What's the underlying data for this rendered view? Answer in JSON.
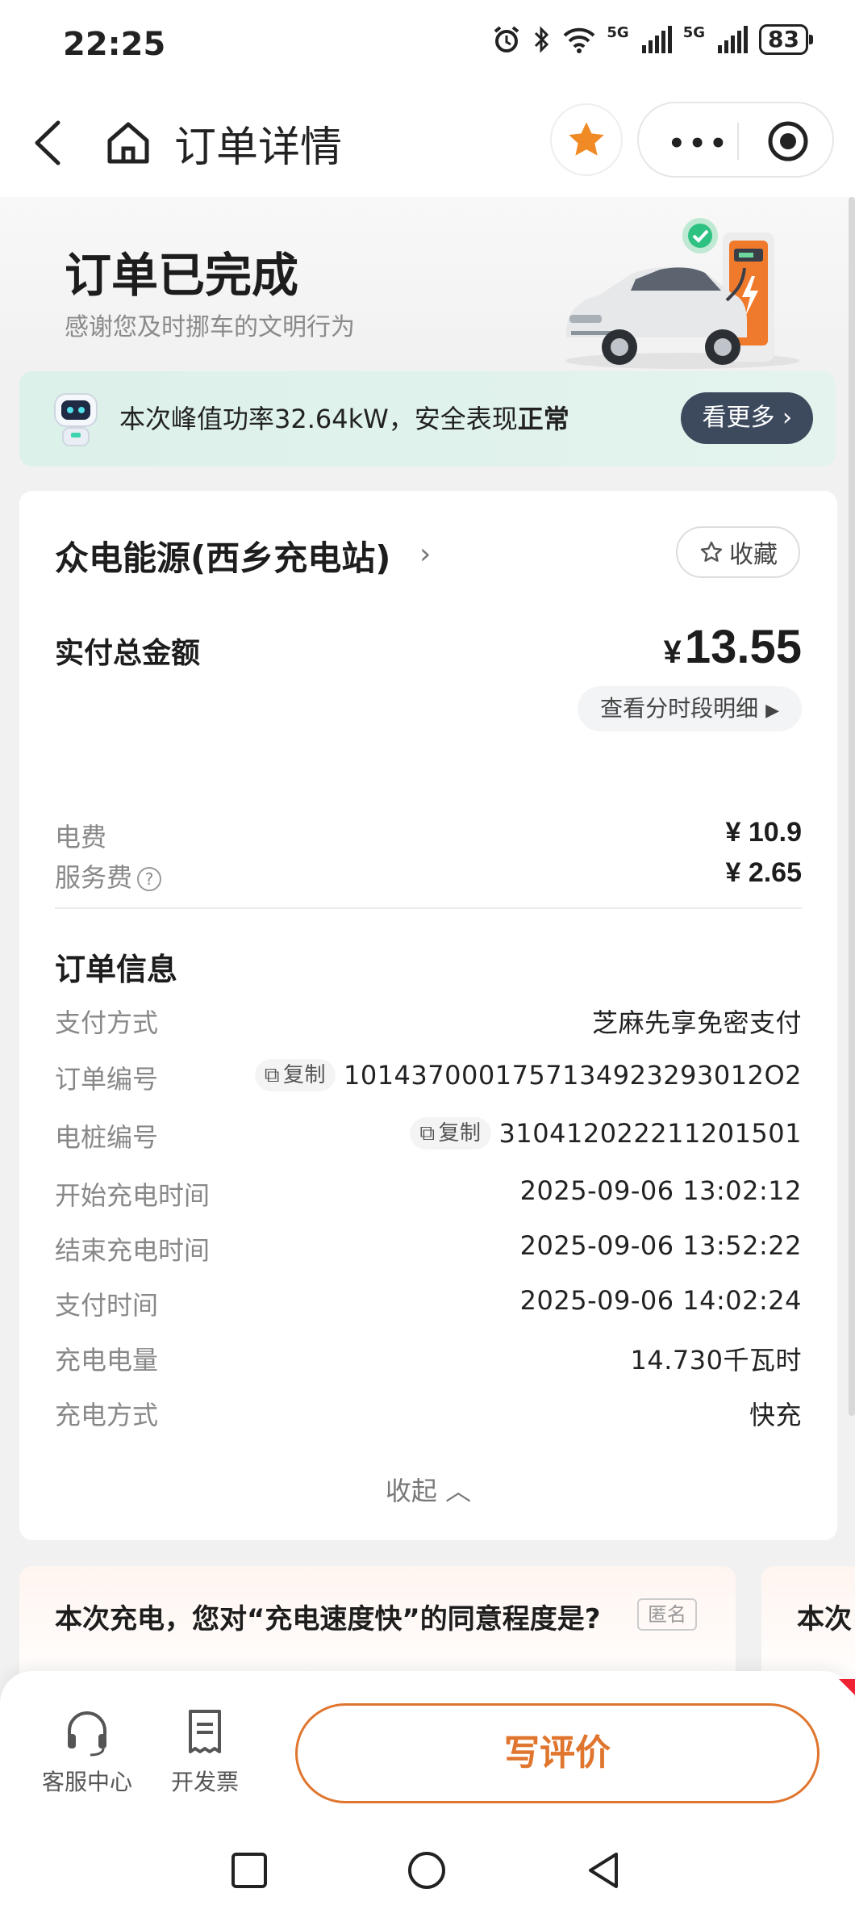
{
  "status_bar": {
    "time": "22:25",
    "net1": "5G",
    "net2": "5G",
    "battery": "83"
  },
  "nav": {
    "title": "订单详情",
    "more": "•••"
  },
  "hero": {
    "title": "订单已完成",
    "subtitle": "感谢您及时挪车的文明行为"
  },
  "banner": {
    "text_prefix": "本次峰值功率32.64kW，安全表现",
    "text_status": "正常",
    "button": "看更多"
  },
  "station": {
    "name": "众电能源(西乡充电站)",
    "chevron": "›",
    "favorite": "收藏"
  },
  "payment": {
    "total_label": "实付总金额",
    "currency": "¥",
    "total": "13.55",
    "period_detail": "查看分时段明细",
    "fees": [
      {
        "label": "电费",
        "value": "¥ 10.9"
      },
      {
        "label": "服务费",
        "value": "¥ 2.65"
      }
    ]
  },
  "order_info": {
    "title": "订单信息",
    "copy_label": "复制",
    "rows": [
      {
        "label": "支付方式",
        "value": "芝麻先享免密支付"
      },
      {
        "label": "订单编号",
        "value": "1014370001757134923293012O2"
      },
      {
        "label": "电桩编号",
        "value": "310412022211201501"
      },
      {
        "label": "开始充电时间",
        "value": "2025-09-06 13:02:12"
      },
      {
        "label": "结束充电时间",
        "value": "2025-09-06 13:52:22"
      },
      {
        "label": "支付时间",
        "value": "2025-09-06 14:02:24"
      },
      {
        "label": "充电电量",
        "value": "14.730千瓦时"
      },
      {
        "label": "充电方式",
        "value": "快充"
      }
    ],
    "collapse": "收起"
  },
  "survey": {
    "question": "本次充电，您对“充电速度快”的同意程度是?",
    "anonymous": "匿名",
    "next_prefix": "本次"
  },
  "bottom_bar": {
    "service": "客服中心",
    "invoice": "开发票",
    "review": "写评价"
  },
  "colors": {
    "accent": "#e0752e",
    "banner_bg": "#dcf1ea",
    "button_dark": "#3d4a5e",
    "star": "#f08a24"
  }
}
